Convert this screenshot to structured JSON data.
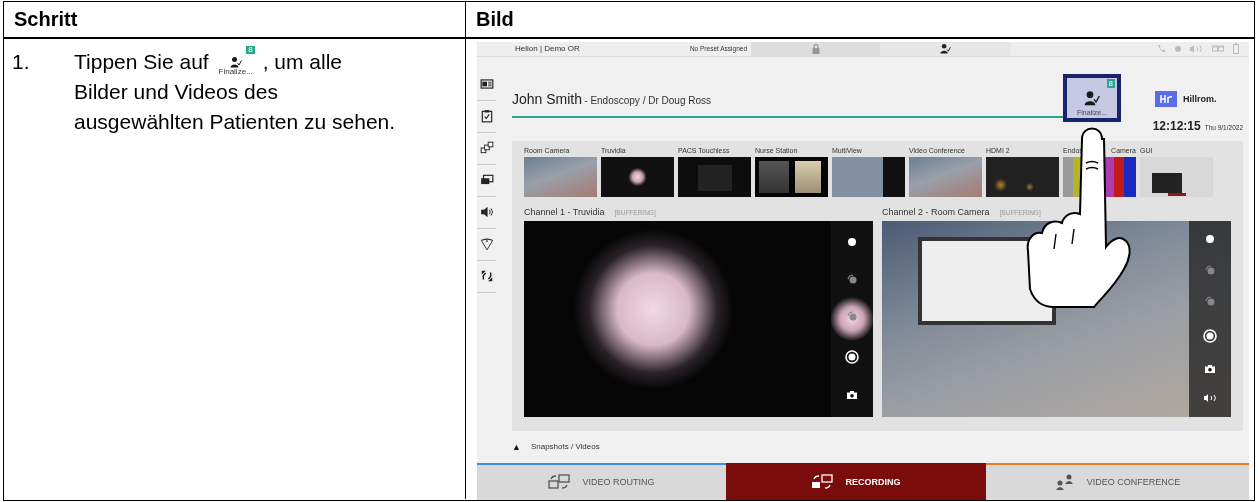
{
  "table": {
    "columns": [
      "Schritt",
      "Bild"
    ]
  },
  "step": {
    "number": "1.",
    "text_before": "Tippen Sie auf",
    "icon_badge": "8",
    "icon_label": "Finalize...",
    "text_after": ", um alle",
    "text_rest": "Bilder und Videos des ausgewählten Patienten zu sehen."
  },
  "screen": {
    "top_bar": {
      "room": "Helion | Demo OR",
      "preset": "No Preset Assigned"
    },
    "patient": {
      "name": "John Smith",
      "details": "- Endoscopy / Dr Doug Ross"
    },
    "finalize_button": {
      "badge": "8",
      "label": "Finalize..."
    },
    "logo": {
      "name": "Hillrom."
    },
    "clock": {
      "time": "12:12:15",
      "date": "Thu 9/1/2022"
    },
    "sources": [
      {
        "label": "Room Camera",
        "kind": "room"
      },
      {
        "label": "Truvidia",
        "kind": "endoscope"
      },
      {
        "label": "PACS Touchless",
        "kind": "document"
      },
      {
        "label": "Nurse Station",
        "kind": "ct"
      },
      {
        "label": "MultiView",
        "kind": "multiview"
      },
      {
        "label": "Video Conference",
        "kind": "room"
      },
      {
        "label": "HDMI 2",
        "kind": "dark"
      },
      {
        "label": "Endos",
        "label_after_hand": "Camera",
        "kind": "colorbars"
      },
      {
        "label": "GUI",
        "kind": "gui"
      }
    ],
    "channels": [
      {
        "title": "Channel 1 - Truvidia",
        "status": "[BUFFERING]",
        "kind": "endoscope",
        "audio": false
      },
      {
        "title": "Channel 2 - Room Camera",
        "status": "[BUFFERING]",
        "kind": "room",
        "audio": true
      }
    ],
    "snapshots": {
      "toggle": "▲",
      "label": "Snapshots / Videos"
    },
    "tabs": [
      {
        "label": "VIDEO ROUTING",
        "kind": "routing",
        "selected": false,
        "color": "#3b8fe0"
      },
      {
        "label": "RECORDING",
        "kind": "recording",
        "selected": true,
        "color": "#7a0c0c"
      },
      {
        "label": "VIDEO CONFERENCE",
        "kind": "conference",
        "selected": false,
        "color": "#e57b22"
      }
    ]
  }
}
